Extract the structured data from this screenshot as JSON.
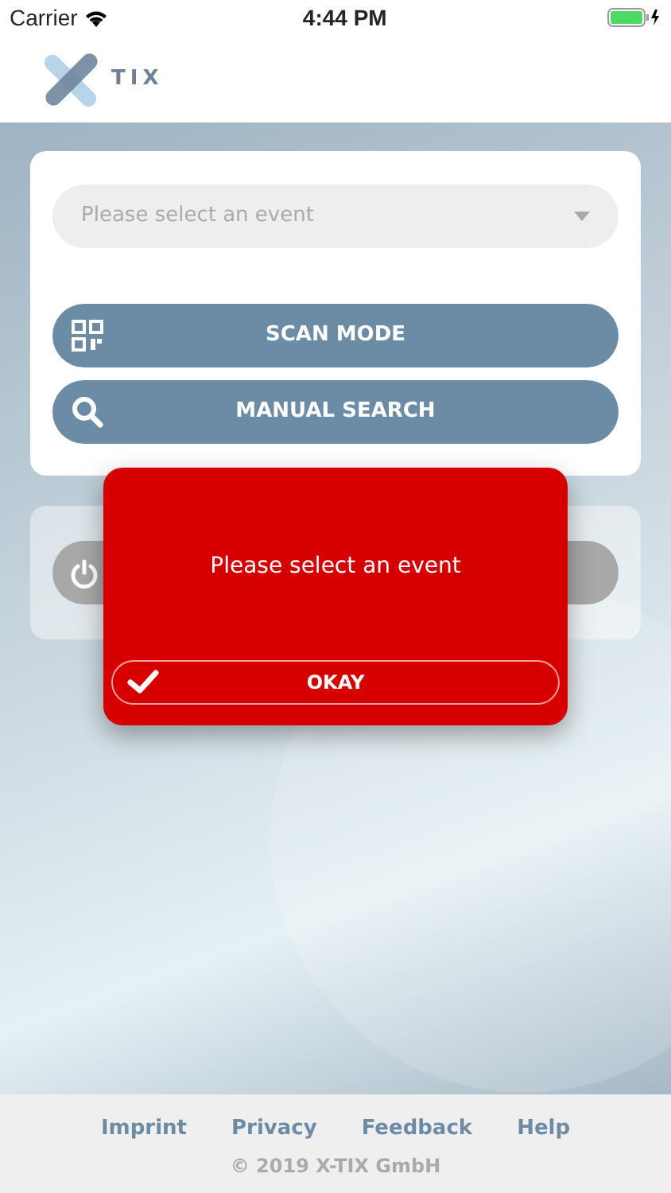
{
  "status_bar": {
    "carrier": "Carrier",
    "time": "4:44 PM"
  },
  "header": {
    "logo_text": "TIX"
  },
  "event_select": {
    "placeholder": "Please select an event"
  },
  "buttons": [
    {
      "label": "SCAN MODE",
      "kind": "scan"
    },
    {
      "label": "MANUAL SEARCH",
      "kind": "search"
    }
  ],
  "alert": {
    "message": "Please select an event",
    "button": "OKAY"
  },
  "footer": {
    "links": [
      "Imprint",
      "Privacy",
      "Feedback",
      "Help"
    ],
    "copyright": "© 2019 X-TIX GmbH"
  }
}
